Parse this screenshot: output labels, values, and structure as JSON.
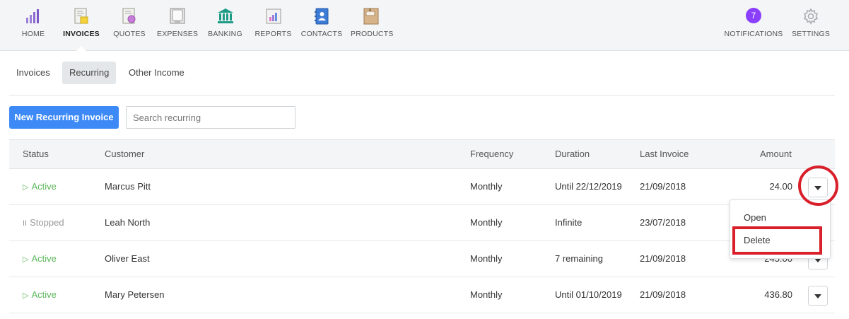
{
  "nav": {
    "items": [
      {
        "label": "HOME"
      },
      {
        "label": "INVOICES"
      },
      {
        "label": "QUOTES"
      },
      {
        "label": "EXPENSES"
      },
      {
        "label": "BANKING"
      },
      {
        "label": "REPORTS"
      },
      {
        "label": "CONTACTS"
      },
      {
        "label": "PRODUCTS"
      }
    ],
    "active": "INVOICES",
    "notifications": {
      "label": "NOTIFICATIONS",
      "count": "7"
    },
    "settings": {
      "label": "SETTINGS"
    }
  },
  "subtabs": [
    {
      "label": "Invoices"
    },
    {
      "label": "Recurring",
      "selected": true
    },
    {
      "label": "Other Income"
    }
  ],
  "toolbar": {
    "new_button_label": "New Recurring Invoice",
    "search_placeholder": "Search recurring"
  },
  "table": {
    "headers": {
      "status": "Status",
      "customer": "Customer",
      "frequency": "Frequency",
      "duration": "Duration",
      "last_invoice": "Last Invoice",
      "amount": "Amount"
    },
    "rows": [
      {
        "status": "Active",
        "status_glyph": "▷",
        "customer": "Marcus Pitt",
        "frequency": "Monthly",
        "duration": "Until 22/12/2019",
        "last_invoice": "21/09/2018",
        "amount": "24.00"
      },
      {
        "status": "Stopped",
        "status_glyph": "II",
        "customer": "Leah North",
        "frequency": "Monthly",
        "duration": "Infinite",
        "last_invoice": "23/07/2018",
        "amount": ""
      },
      {
        "status": "Active",
        "status_glyph": "▷",
        "customer": "Oliver East",
        "frequency": "Monthly",
        "duration": "7 remaining",
        "last_invoice": "21/09/2018",
        "amount": "245.00"
      },
      {
        "status": "Active",
        "status_glyph": "▷",
        "customer": "Mary Petersen",
        "frequency": "Monthly",
        "duration": "Until 01/10/2019",
        "last_invoice": "21/09/2018",
        "amount": "436.80"
      }
    ]
  },
  "row_menu": {
    "items": [
      {
        "label": "Open"
      },
      {
        "label": "Delete"
      }
    ]
  },
  "colors": {
    "primary": "#3d8af7",
    "active_status": "#5cb85c",
    "notification_badge": "#8a3ffc",
    "annotation": "#d81f2a"
  },
  "icons": {
    "home": "bar-chart-icon",
    "invoices": "invoice-document-icon",
    "quotes": "quote-document-icon",
    "expenses": "receipt-icon",
    "banking": "bank-icon",
    "reports": "report-chart-icon",
    "contacts": "address-book-icon",
    "products": "product-box-icon",
    "settings": "gear-icon"
  }
}
